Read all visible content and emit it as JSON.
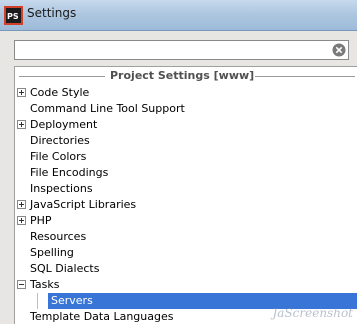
{
  "window": {
    "title": "Settings",
    "app_icon": "phpstorm-logo-icon"
  },
  "search": {
    "value": "",
    "placeholder": ""
  },
  "tree": {
    "section_title": "Project Settings [www]",
    "items": [
      {
        "label": "Code Style",
        "expandable": true
      },
      {
        "label": "Command Line Tool Support",
        "expandable": false
      },
      {
        "label": "Deployment",
        "expandable": true
      },
      {
        "label": "Directories",
        "expandable": false
      },
      {
        "label": "File Colors",
        "expandable": false
      },
      {
        "label": "File Encodings",
        "expandable": false
      },
      {
        "label": "Inspections",
        "expandable": false
      },
      {
        "label": "JavaScript Libraries",
        "expandable": true
      },
      {
        "label": "PHP",
        "expandable": true
      },
      {
        "label": "Resources",
        "expandable": false
      },
      {
        "label": "Spelling",
        "expandable": false
      },
      {
        "label": "SQL Dialects",
        "expandable": false
      },
      {
        "label": "Tasks",
        "expandable": true,
        "expanded": true
      },
      {
        "label": "Servers",
        "child": true,
        "selected": true
      },
      {
        "label": "Template Data Languages",
        "expandable": false
      }
    ]
  },
  "colors": {
    "selection": "#3875d7",
    "titlebar": "#aec7e0"
  },
  "watermark": "JaScreenshot"
}
